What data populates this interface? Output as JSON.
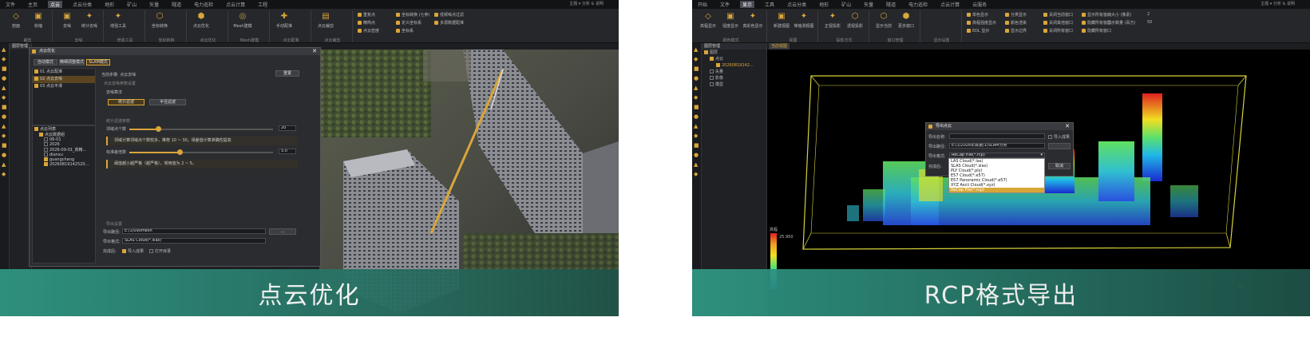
{
  "left": {
    "menu": [
      "文件",
      "主页",
      "点云",
      "点云分类",
      "地形",
      "矿山",
      "矢量",
      "隧道",
      "电力巡检",
      "点云计算",
      "工程"
    ],
    "menu_active": 2,
    "menu_right": "主题 ▾   分析 & 说明",
    "ribbon_groups": [
      {
        "name": "裁剪",
        "buttons": [
          "剖面",
          "收缩"
        ]
      },
      {
        "name": "去噪",
        "buttons": [
          "去噪",
          "统计去噪"
        ]
      },
      {
        "name": "增强工具",
        "buttons": [
          "增强工具"
        ]
      },
      {
        "name": "坐标转换",
        "buttons": [
          "坐标转换"
        ]
      },
      {
        "name": "点云优化",
        "buttons": [
          "点云优化"
        ]
      },
      {
        "name": "Mesh建模",
        "buttons": [
          "Mesh建模"
        ]
      },
      {
        "name": "点云配准",
        "buttons": [
          "手动配准"
        ]
      },
      {
        "name": "点云裁剪",
        "buttons": [
          "点云裁剪"
        ]
      }
    ],
    "ribbon_smalls": [
      "重复点",
      "精简点",
      "点云密度",
      "坐标转换 (七参)",
      "定义坐标系",
      "坐标系",
      "低频噪点过滤",
      "多源数据配准"
    ],
    "tree_header": "图层管理",
    "tree_rows": [
      "点云列表",
      "点云数据组",
      "06-01",
      "2026",
      "2026-09-01_高精...",
      "dianxu",
      "guangchang",
      "20260819142520..."
    ],
    "dialog": {
      "title": "点云优化",
      "modes": [
        "自动模式",
        "精细调整模式",
        "SLAM模式"
      ],
      "steps": [
        "01 点云配准",
        "02 点云去噪",
        "03 点云平滑"
      ],
      "current_step": "当前步骤: 点云去噪",
      "reset": "重置",
      "section_label": "点云去噪参数设置",
      "algo_label": "去噪算法",
      "algo_buttons": [
        "统计滤波",
        "半径滤波"
      ],
      "sub_label": "统计滤波参数",
      "param1_label": "邻域点个数",
      "param1_value": "20",
      "param1_fraction": 0.2,
      "param1_note": "邻域计算邻域点个数较多，推荐 10 ~ 30，误差值计算准确性提高",
      "param2_label": "标准差倍数",
      "param2_value": "5.0",
      "param2_fraction": 0.35,
      "param2_note": "阈值越小越严格（越严格），常用值为 2 ~ 5。",
      "export_section": "导出设置",
      "export_path_label": "导出路径:",
      "export_path": "E:/1/090mesh",
      "export_format_label": "导出格式:",
      "export_format": "SLAS Cloud(*.slas)",
      "done_label": "完成后:",
      "opt1": "导入成果",
      "opt2": "打开目录",
      "browse": "..."
    },
    "caption": "点云优化"
  },
  "right": {
    "menu": [
      "开始",
      "文件",
      "显示",
      "工具",
      "点云分类",
      "地形",
      "矿山",
      "矢量",
      "隧道",
      "电力巡检",
      "点云计算",
      "云服务"
    ],
    "menu_active": 2,
    "menu_right": "主题 ▾   分析 & 说明",
    "ribbon_groups": [
      {
        "name": "颜色模式",
        "buttons": [
          "高程显示",
          "强度显示",
          "真彩色显示"
        ]
      },
      {
        "name": "视图",
        "buttons": [
          "新建视图",
          "等轴测视图"
        ]
      },
      {
        "name": "投影方式",
        "buttons": [
          "正视投影",
          "透视投影"
        ]
      },
      {
        "name": "窗口管理",
        "buttons": [
          "显示当前",
          "更多窗口"
        ]
      },
      {
        "name": "显示设置",
        "buttons": []
      }
    ],
    "ribbon_smalls": [
      "单色显示",
      "高程强度显示",
      "EDL 显示",
      "分类显示",
      "颜色渲染",
      "显示边界",
      "关闭当前窗口",
      "关闭其他窗口",
      "关闭所有窗口",
      "显示所有窗口",
      "隐藏所有窗口",
      "隐藏所有窗口"
    ],
    "point_size_label": "点大小 (像素)",
    "point_size": "2",
    "display_count_label": "显示数量 (百万)",
    "display_count": "50",
    "tree_header": "图层管理",
    "tree_rows": [
      "图层",
      "点云",
      "20260819142...",
      "矢量",
      "影像",
      "模型"
    ],
    "tab_label": "当前视图",
    "legend_label": "高程",
    "legend_max": "25.950",
    "dialog": {
      "title": "导出点云",
      "name_label": "导出名称:",
      "name_value": "",
      "path_label": "导出路径:",
      "path_value": "E:/1/2026年数据/1/SLAM分类",
      "format_label": "导出格式:",
      "format_value": "ReCap File(*.rcp)",
      "done_label": "完成后:",
      "checkbox": "导入成果",
      "cancel": "取消",
      "options": [
        "LAS Cloud(*.las)",
        "SLAS Cloud(*.slas)",
        "PLY Cloud(*.ply)",
        "E57 Cloud(*.e57)",
        "E57 Panoramic Cloud(*.e57)",
        "XYZ Ascii Cloud(*.xyz)",
        "ReCap File(*.rcp)"
      ],
      "selected_option": 6
    },
    "scale_text": "5E",
    "caption": "RCP格式导出"
  },
  "colors": {
    "accent": "#d9a63a",
    "caption_bg": "#2f9884"
  }
}
